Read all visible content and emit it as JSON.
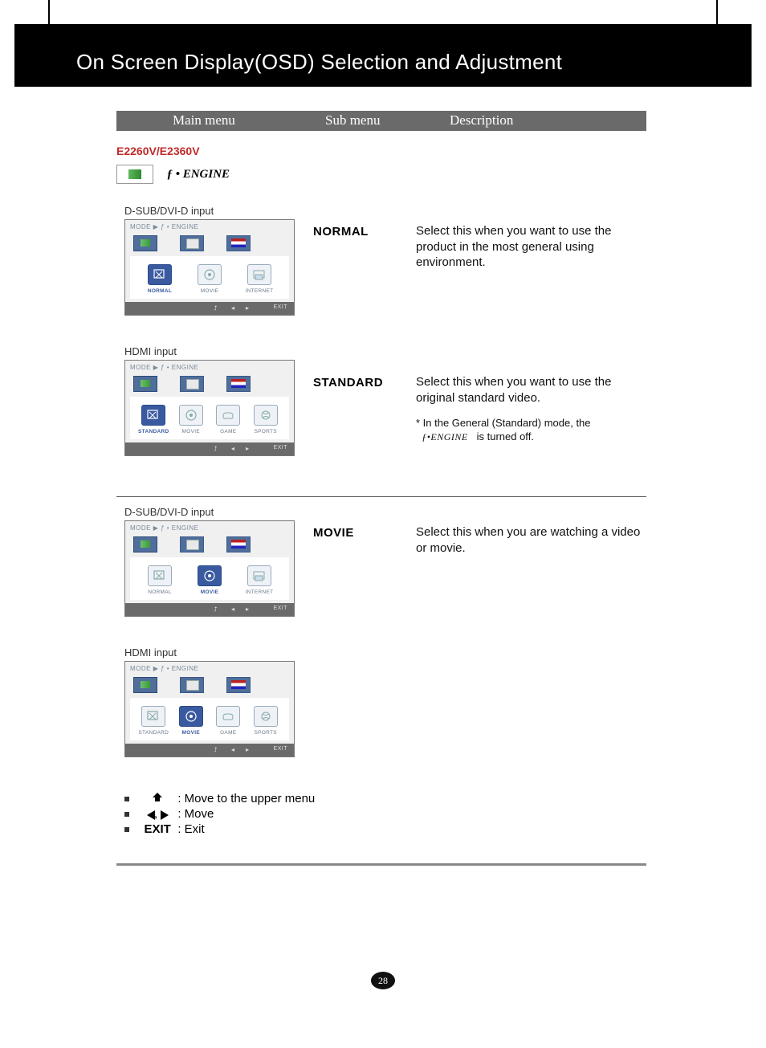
{
  "page_title": "On Screen Display(OSD) Selection and Adjustment",
  "headers": {
    "main": "Main menu",
    "sub": "Sub menu",
    "desc": "Description"
  },
  "model": "E2260V/E2360V",
  "engine_label": "ENGINE",
  "captions": {
    "dsub": "D-SUB/DVI-D input",
    "hdmi": "HDMI input"
  },
  "osd": {
    "title": "MODE  ▶  ƒ • ENGINE",
    "exit": "EXIT",
    "dsub_opts": [
      "NORMAL",
      "MOVIE",
      "INTERNET"
    ],
    "hdmi_opts": [
      "STANDARD",
      "MOVIE",
      "GAME",
      "SPORTS"
    ]
  },
  "rows": {
    "normal": {
      "sub": "NORMAL",
      "desc": "Select this when you want to use the product in the most general using environment."
    },
    "standard": {
      "sub": "STANDARD",
      "desc": "Select this when you want to use the original standard video.",
      "note_a": "* In the General (Standard) mode, the",
      "note_b": "is turned off.",
      "fengine": "ƒ•ENGINE"
    },
    "movie": {
      "sub": "MOVIE",
      "desc": "Select this when you are watching a video or movie."
    }
  },
  "legend": {
    "up": ": Move to the upper menu",
    "move": ": Move",
    "exit_label": "EXIT",
    "exit_desc": ": Exit",
    "comma": ","
  },
  "page_number": "28"
}
